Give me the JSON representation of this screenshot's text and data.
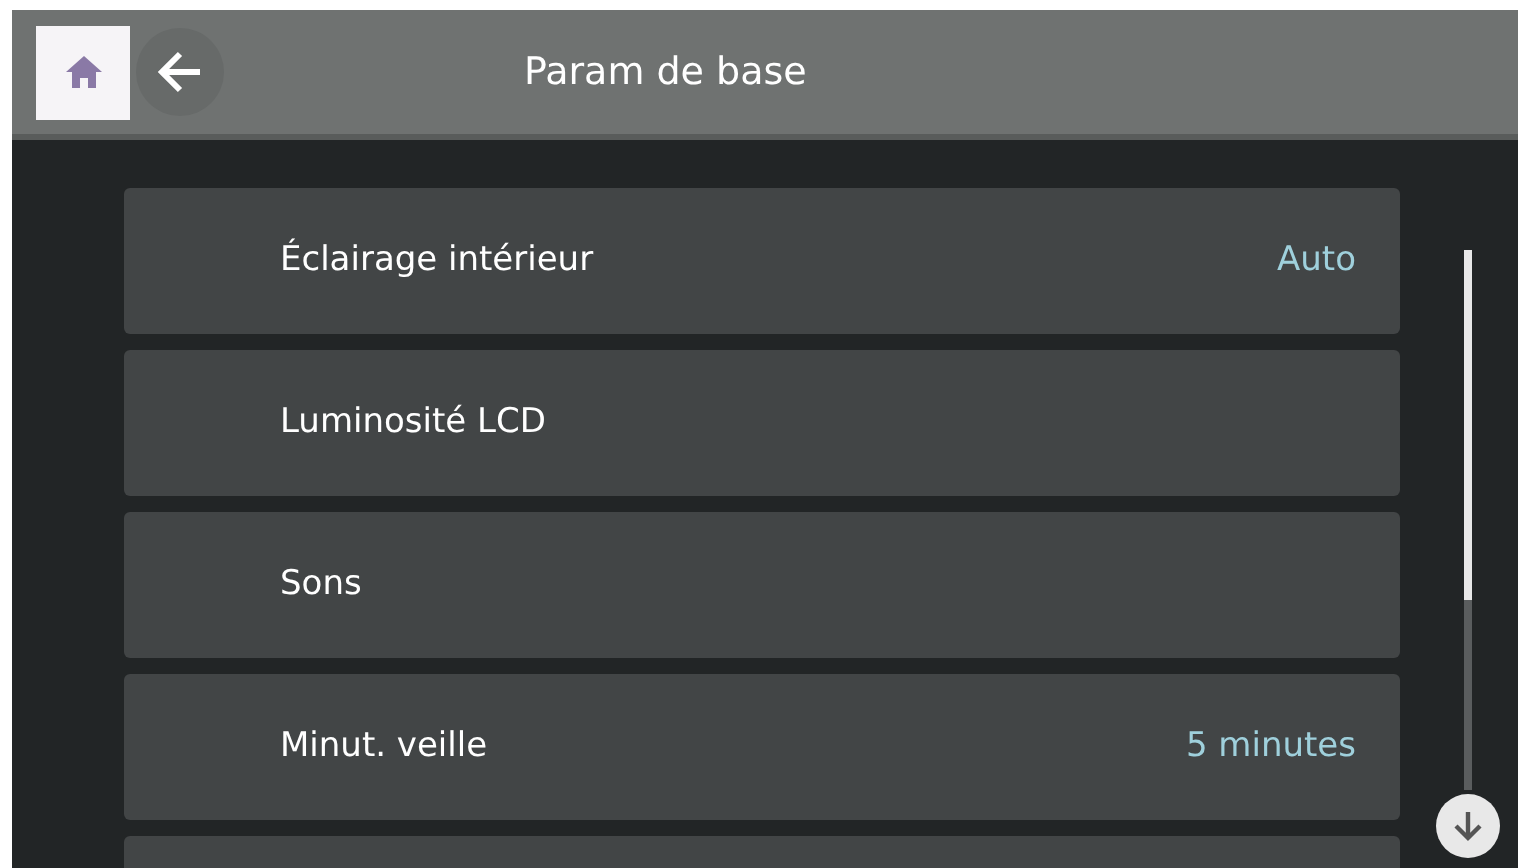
{
  "header": {
    "title": "Param de base"
  },
  "items": [
    {
      "label": "Éclairage intérieur",
      "value": "Auto"
    },
    {
      "label": "Luminosité LCD"
    },
    {
      "label": "Sons"
    },
    {
      "label": "Minut. veille",
      "value": "5 minutes"
    }
  ]
}
